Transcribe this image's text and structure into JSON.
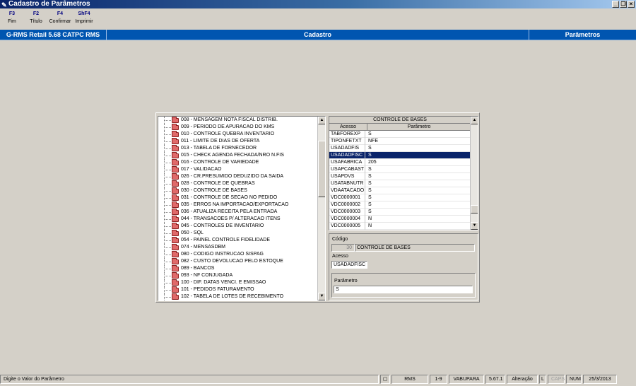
{
  "window": {
    "title": "Cadastro de Parâmetros"
  },
  "toolbar": [
    {
      "key": "F3",
      "label": "Fim"
    },
    {
      "key": "F2",
      "label": "Título"
    },
    {
      "key": "F4",
      "label": "Confirmar"
    },
    {
      "key": "ShF4",
      "label": "Imprimir"
    }
  ],
  "header": {
    "left": "G-RMS Retail 5.68 CATPC RMS",
    "center": "Cadastro",
    "right": "Parâmetros"
  },
  "tree": {
    "items": [
      "008 - MENSAGEM NOTA FISCAL DISTRIB.",
      "009 - PERIODO DE APURACAO DO KMS",
      "010 - CONTROLE QUEBRA INVENTARIO",
      "011 - LIMITE DE DIAS DE OFERTA",
      "013 - TABELA DE FORNECEDOR",
      "015 - CHECK AGENDA FECHADA/NRO N.FIS",
      "016 - CONTROLE DE VARIEDADE",
      "017 - VALIDACAO",
      "026 - CR.PRESUMIDO DEDUZIDO DA SAIDA",
      "028 - CONTROLE DE QUEBRAS",
      "030 - CONTROLE DE BASES",
      "031 - CONTROLE DE SECAO NO PEDIDO",
      "035 - ERROS NA IMPORTACAO/EXPORTACAO",
      "036 - ATUALIZA RECEITA PELA ENTRADA",
      "044 - TRANSACOES P/ ALTERACAO ITENS",
      "045 - CONTROLES DE INVENTARIO",
      "050 - SQL",
      "054 - PAINEL CONTROLE FIDELIDADE",
      "074 - MENSASDBM",
      "080 - CODIGO INSTRUCAO SISPAG",
      "082 - CUSTO DEVOLUCAO PELO ESTOQUE",
      "089 - BANCOS",
      "093 - NF CONJUGADA",
      "100 - DIF. DATAS VENCI. E EMISSAO",
      "101 - PEDIDOS FATURAMENTO",
      "102 - TABELA DE LOTES DE RECEBIMENTO"
    ]
  },
  "grid": {
    "title": "CONTROLE DE BASES",
    "col1": "Acesso",
    "col2": "Parâmetro",
    "rows": [
      {
        "acesso": "TABFOREXP",
        "param": "S"
      },
      {
        "acesso": "TIPONFETXT",
        "param": "NFE"
      },
      {
        "acesso": "USADADFIS",
        "param": "S"
      },
      {
        "acesso": "USADADFISC",
        "param": "S",
        "selected": true
      },
      {
        "acesso": "USAFABRICA",
        "param": "205"
      },
      {
        "acesso": "USAPCABAST",
        "param": "S"
      },
      {
        "acesso": "USAPDVS",
        "param": "S"
      },
      {
        "acesso": "USATABNUTR",
        "param": "S"
      },
      {
        "acesso": "VDAATACADO",
        "param": "S"
      },
      {
        "acesso": "VDC0000001",
        "param": "S"
      },
      {
        "acesso": "VDC0000002",
        "param": "S"
      },
      {
        "acesso": "VDC0000003",
        "param": "S"
      },
      {
        "acesso": "VDC0000004",
        "param": "N"
      },
      {
        "acesso": "VDC0000005",
        "param": "N"
      }
    ]
  },
  "detail": {
    "codigo_label": "Código",
    "codigo_value": "30",
    "codigo_desc": "CONTROLE DE BASES",
    "acesso_label": "Acesso",
    "acesso_value": "USADADFISC",
    "parametro_label": "Parâmetro",
    "parametro_value": "S"
  },
  "status": {
    "message": "Digite o Valor do Parâmetro",
    "system": "RMS",
    "code": "1-9",
    "user": "VABUPARA",
    "version": "5.67.1",
    "mode": "Alteração",
    "l": "L",
    "caps": "CAPS",
    "num": "NUM",
    "date": "25/3/2013"
  }
}
